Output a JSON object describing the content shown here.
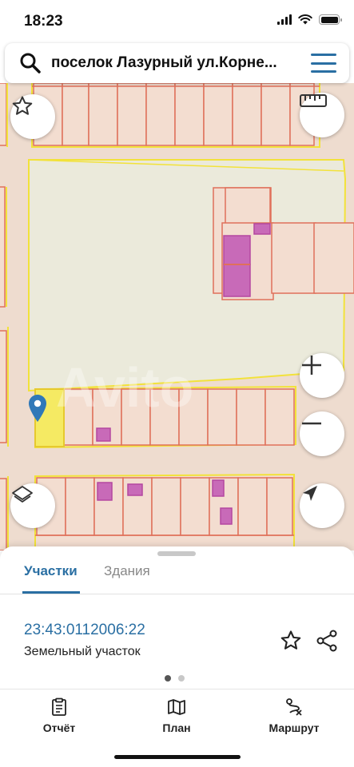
{
  "status_bar": {
    "time": "18:23"
  },
  "search": {
    "query": "поселок Лазурный ул.Корне..."
  },
  "map": {
    "watermark": "Avito"
  },
  "sheet": {
    "tabs": [
      {
        "label": "Участки",
        "active": true
      },
      {
        "label": "Здания",
        "active": false
      }
    ],
    "parcel": {
      "number": "23:43:0112006:22",
      "type": "Земельный участок"
    },
    "page_indicator": {
      "current": 1,
      "total": 2
    }
  },
  "bottom_nav": {
    "items": [
      {
        "label": "Отчёт",
        "icon": "report-icon"
      },
      {
        "label": "План",
        "icon": "map-icon"
      },
      {
        "label": "Маршрут",
        "icon": "route-icon"
      }
    ]
  },
  "colors": {
    "accent": "#2a6fa3",
    "parcel_border": "#e0705a",
    "block_border": "#f2e23a",
    "selected_parcel": "#f5ea63",
    "building": "#c86ab8",
    "map_background": "#eedccf"
  }
}
